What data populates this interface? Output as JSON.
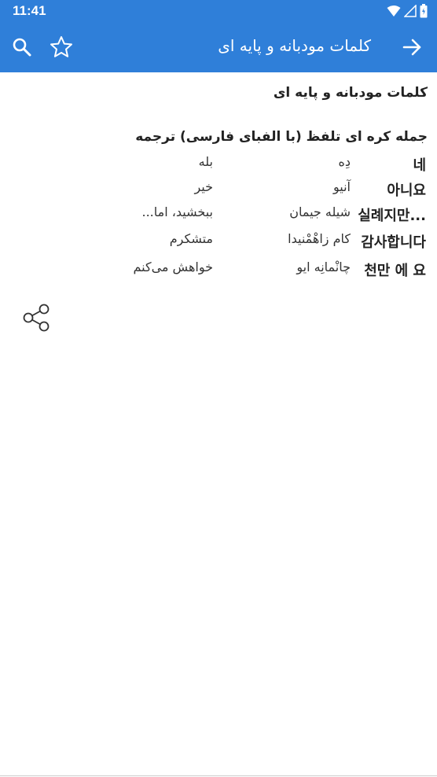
{
  "status_bar": {
    "time": "11:41",
    "icons": [
      "wifi-icon",
      "signal-icon",
      "battery-icon"
    ]
  },
  "app_bar": {
    "title": "کلمات مودبانه و پایه ای",
    "icons": [
      "search-icon",
      "star-outline-icon",
      "arrow-right-icon"
    ],
    "background_color": "#2f7fd9"
  },
  "content": {
    "heading": "کلمات مودبانه و پایه ای",
    "table_header": "جمله کره ای تلفظ (با الفبای فارسی) ترجمه",
    "rows": [
      {
        "korean": "네",
        "pronunciation": "دِه",
        "translation": "بله"
      },
      {
        "korean": "아니요",
        "pronunciation": "آنیو",
        "translation": "خیر"
      },
      {
        "korean": "실례지만...",
        "pronunciation": "شیله جیمان",
        "translation": "ببخشید، اما..."
      },
      {
        "korean": "감사합니다",
        "pronunciation": "کام زاهْمْنیدا",
        "translation": "متشکرم"
      },
      {
        "korean": "천만 에 요",
        "pronunciation": "چانْمانِه ایو",
        "translation": "خواهش می‌کنم"
      }
    ],
    "share_icon": "share-icon"
  }
}
